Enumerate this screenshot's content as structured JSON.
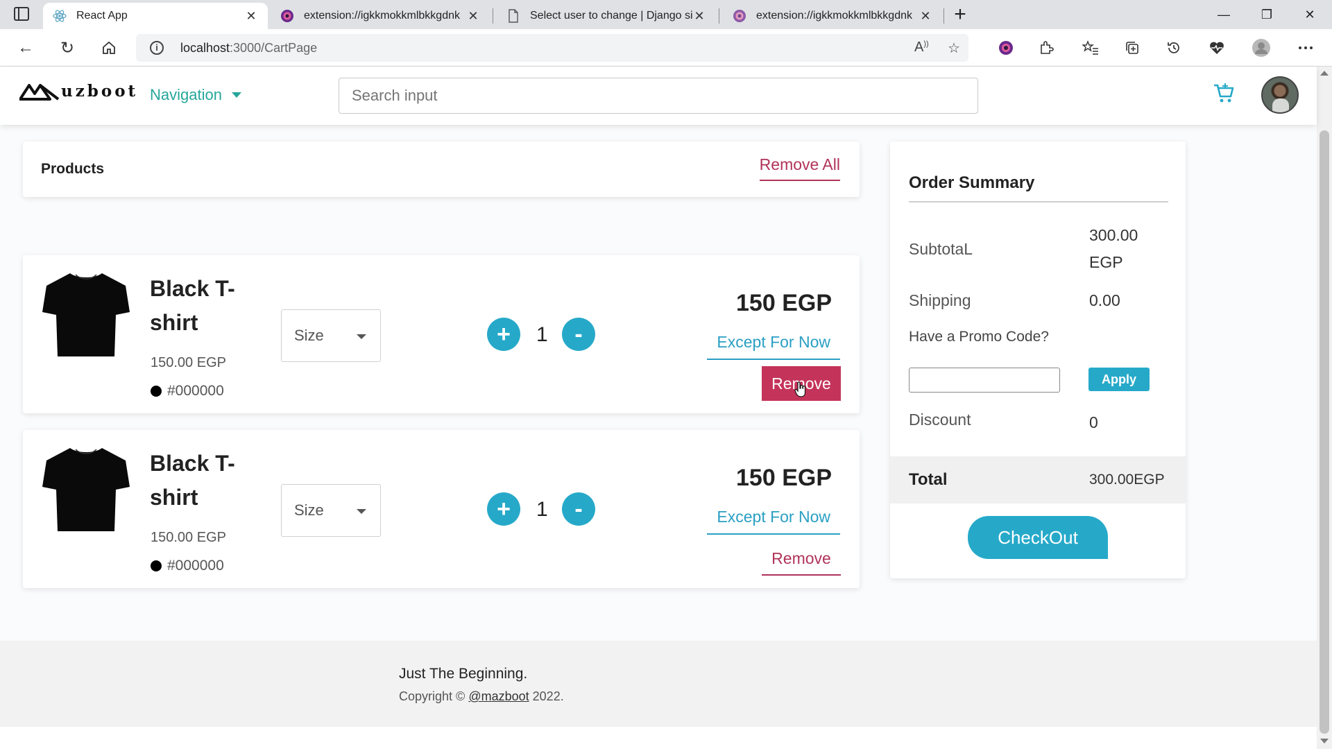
{
  "browser": {
    "tabs": [
      {
        "title": "React App",
        "icon": "react-icon",
        "active": true
      },
      {
        "title": "extension://igkkmokkmlbkkgdnk",
        "icon": "extension-icon",
        "active": false
      },
      {
        "title": "Select user to change | Django si",
        "icon": "page-icon",
        "active": false
      },
      {
        "title": "extension://igkkmokkmlbkkgdnk",
        "icon": "extension-icon",
        "active": false
      }
    ],
    "new_tab": "+",
    "url_host": "localhost",
    "url_path": ":3000/CartPage"
  },
  "header": {
    "logo_text": "uzboot",
    "nav_label": "Navigation",
    "search_placeholder": "Search input"
  },
  "products": {
    "heading": "Products",
    "remove_all": "Remove All",
    "items": [
      {
        "name": "Black T-shirt",
        "unit_price": "150.00 EGP",
        "color": "#000000",
        "size_placeholder": "Size",
        "quantity": "1",
        "plus": "+",
        "minus": "-",
        "price": "150 EGP",
        "except_label": "Except For Now",
        "remove_label": "Remove"
      },
      {
        "name": "Black T-shirt",
        "unit_price": "150.00 EGP",
        "color": "#000000",
        "size_placeholder": "Size",
        "quantity": "1",
        "plus": "+",
        "minus": "-",
        "price": "150 EGP",
        "except_label": "Except For Now",
        "remove_label": "Remove"
      }
    ]
  },
  "summary": {
    "title": "Order Summary",
    "subtotal_label": "SubtotaL",
    "subtotal_value": "300.00 EGP",
    "shipping_label": "Shipping",
    "shipping_value": "0.00",
    "promo_question": "Have a Promo Code?",
    "apply_label": "Apply",
    "discount_label": "Discount",
    "discount_value": "0",
    "total_label": "Total",
    "total_value": "300.00EGP",
    "checkout_label": "CheckOut"
  },
  "footer": {
    "tagline": "Just The Beginning.",
    "copyright_prefix": "Copyright ©",
    "copyright_link": "@mazboot",
    "copyright_year": "2022."
  },
  "colors": {
    "accent": "#26a9c9",
    "nav_teal": "#26a69a",
    "danger": "#c4345a"
  }
}
